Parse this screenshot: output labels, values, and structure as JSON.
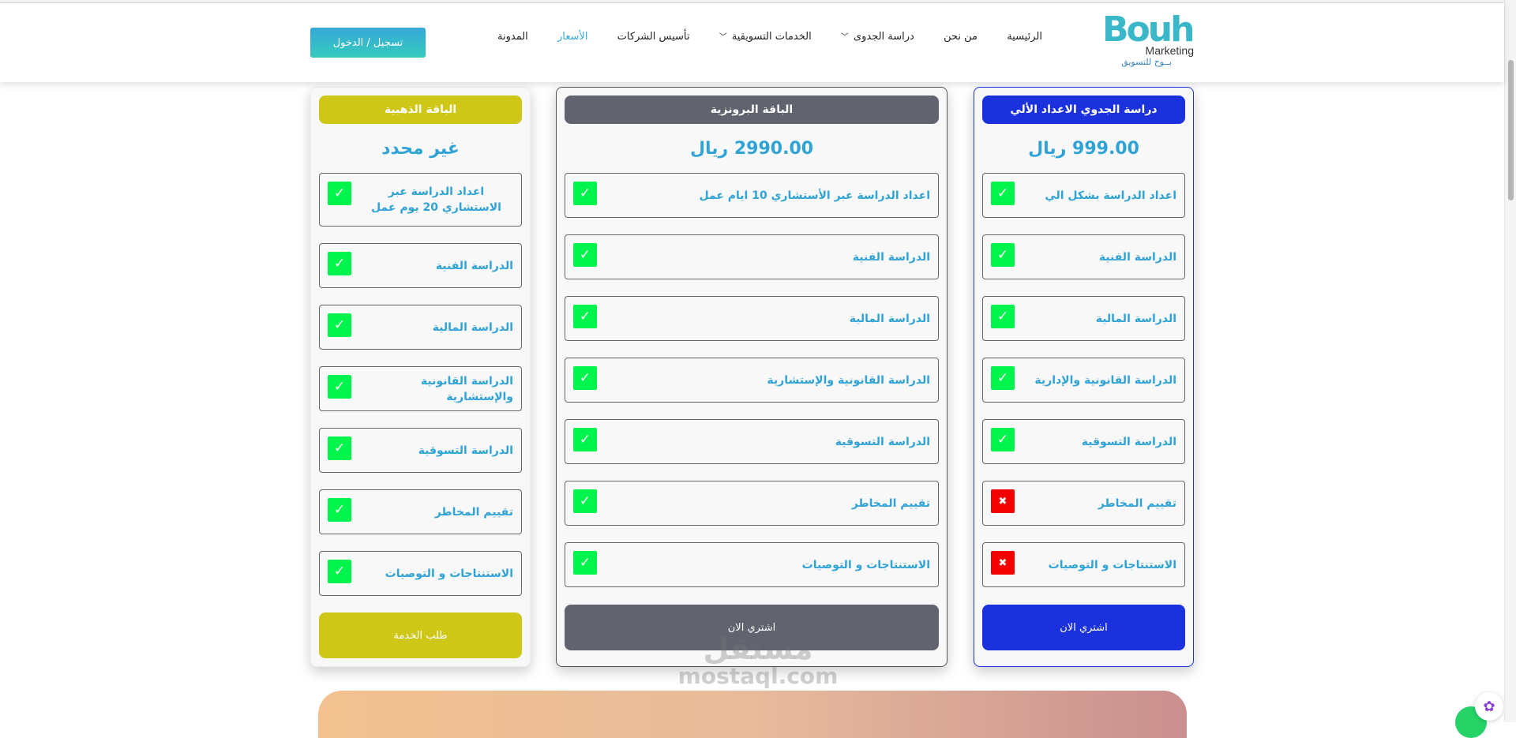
{
  "header": {
    "logo": {
      "mark": "Bouh",
      "sub": "Marketing",
      "ar": "بــوح للتسويق"
    },
    "nav": [
      {
        "label": "الرئيسية",
        "active": false,
        "dropdown": false
      },
      {
        "label": "من نحن",
        "active": false,
        "dropdown": false
      },
      {
        "label": "دراسة الجدوى",
        "active": false,
        "dropdown": true
      },
      {
        "label": "الخدمات التسويقية",
        "active": false,
        "dropdown": true
      },
      {
        "label": "تأسيس الشركات",
        "active": false,
        "dropdown": false
      },
      {
        "label": "الأسعار",
        "active": true,
        "dropdown": false
      },
      {
        "label": "المدونة",
        "active": false,
        "dropdown": false
      }
    ],
    "login_label": "تسجيل / الدخول"
  },
  "plans": {
    "blue": {
      "title": "دراسة الجدوي الاعداد الألي",
      "price": "999.00 ريال",
      "color": "#1b31de",
      "button": "اشتري الان",
      "features": [
        {
          "label": "اعداد الدراسة بشكل الي",
          "included": true
        },
        {
          "label": "الدراسة الفنية",
          "included": true
        },
        {
          "label": "الدراسة المالية",
          "included": true
        },
        {
          "label": "الدراسة القانونية والإدارية",
          "included": true
        },
        {
          "label": "الدراسة التسوقية",
          "included": true
        },
        {
          "label": "تقييم المخاطر",
          "included": false
        },
        {
          "label": "الاستنتاجات و التوصيات",
          "included": false
        }
      ]
    },
    "bronze": {
      "title": "الباقة البرونزية",
      "price": "2990.00 ريال",
      "color": "#61636f",
      "button": "اشتري الان",
      "features": [
        {
          "label": "اعداد الدراسة عبر الأستشاري 10 ايام عمل",
          "included": true
        },
        {
          "label": "الدراسة الفنية",
          "included": true
        },
        {
          "label": "الدراسة المالية",
          "included": true
        },
        {
          "label": "الدراسة القانونية والإستشارية",
          "included": true
        },
        {
          "label": "الدراسة التسوقية",
          "included": true
        },
        {
          "label": "تقييم المخاطر",
          "included": true
        },
        {
          "label": "الاستنتاجات و التوصيات",
          "included": true
        }
      ]
    },
    "gold": {
      "title": "الباقة الذهبية",
      "price": "غير محدد",
      "color": "#cfc718",
      "button": "طلب الخدمة",
      "features": [
        {
          "label": "اعداد الدراسة عبر الاستشاري 20 يوم عمل",
          "included": true
        },
        {
          "label": "الدراسة الفنية",
          "included": true
        },
        {
          "label": "الدراسة المالية",
          "included": true
        },
        {
          "label": "الدراسة القانونية والإستشارية",
          "included": true
        },
        {
          "label": "الدراسة التسوقية",
          "included": true
        },
        {
          "label": "تقييم المخاطر",
          "included": true
        },
        {
          "label": "الاستنتاجات و التوصيات",
          "included": true
        }
      ]
    }
  },
  "watermark": {
    "ar": "مستقل",
    "en": "mostaql.com"
  },
  "icons": {
    "included": "check-icon",
    "excluded": "close-icon"
  }
}
